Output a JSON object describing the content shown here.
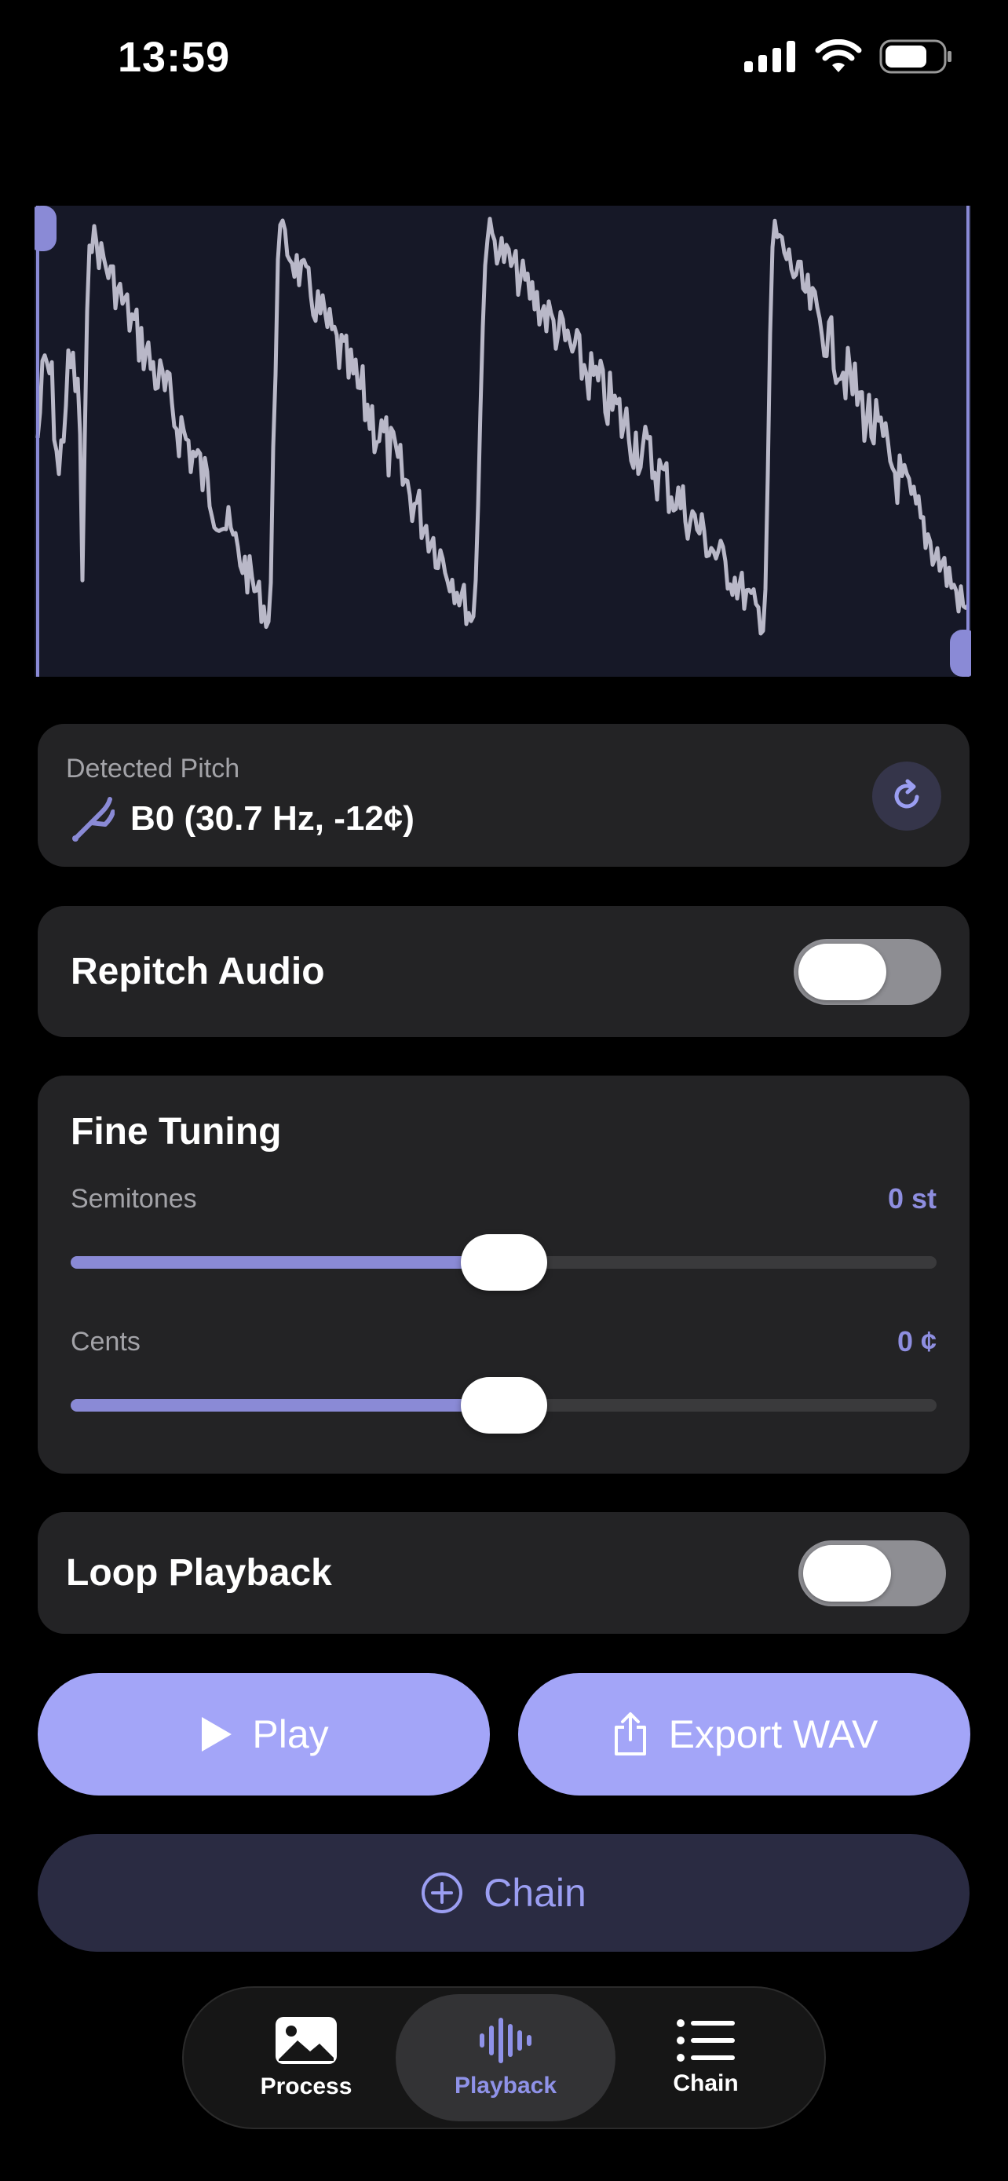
{
  "status_bar": {
    "time": "13:59"
  },
  "detected_pitch": {
    "label": "Detected Pitch",
    "value": "B0 (30.7 Hz, -12¢)"
  },
  "repitch": {
    "label": "Repitch Audio",
    "enabled": false
  },
  "fine_tuning": {
    "title": "Fine Tuning",
    "semitones": {
      "label": "Semitones",
      "value": "0 st",
      "position": 0.5
    },
    "cents": {
      "label": "Cents",
      "value": "0 ¢",
      "position": 0.5
    }
  },
  "loop": {
    "label": "Loop Playback",
    "enabled": false
  },
  "actions": {
    "play_label": "Play",
    "export_label": "Export WAV",
    "chain_label": "Chain"
  },
  "tabs": [
    {
      "label": "Process",
      "icon": "photo-icon",
      "active": false
    },
    {
      "label": "Playback",
      "icon": "waveform-icon",
      "active": true
    },
    {
      "label": "Chain",
      "icon": "list-icon",
      "active": false
    }
  ],
  "colors": {
    "accent": "#a3a5f8",
    "accent_text": "#8f92e8",
    "card": "#232325",
    "waveform_bg": "#161827",
    "waveform_line": "#b9b8c8"
  }
}
